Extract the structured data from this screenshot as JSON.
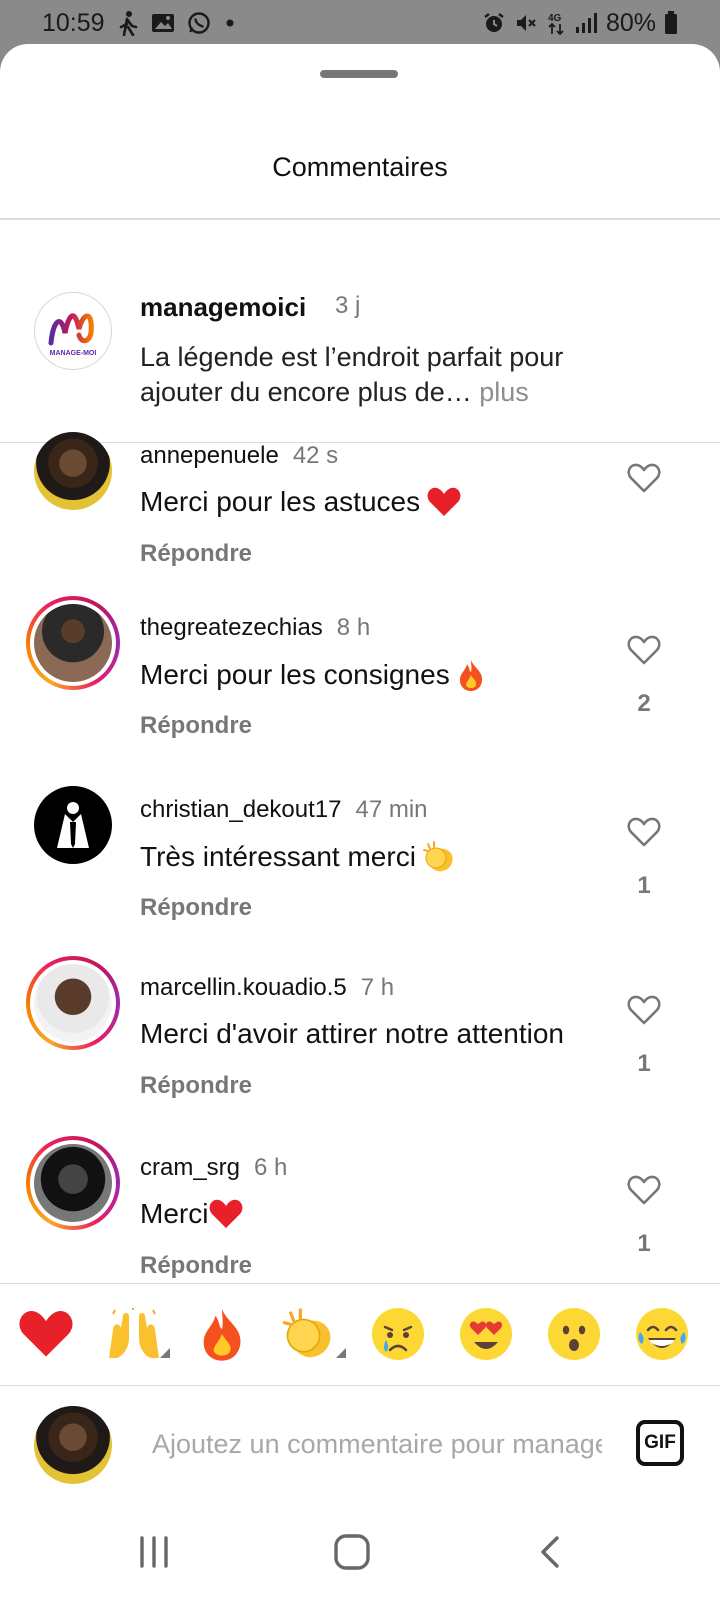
{
  "status_bar": {
    "time": "10:59",
    "battery": "80%",
    "network": "4G"
  },
  "sheet": {
    "title": "Commentaires"
  },
  "caption": {
    "author": "managemoici",
    "time": "3 j",
    "text": "La légende est l’endroit parfait pour ajouter du encore plus de…",
    "more_label": " plus",
    "logo_text": "MANAGE-MOI"
  },
  "comments": [
    {
      "author": "annepenuele",
      "time": "42 s",
      "text": "Merci pour les astuces",
      "emoji": "heart",
      "reply_label": "Répondre",
      "likes": ""
    },
    {
      "author": "thegreatezechias",
      "time": "8 h",
      "text": "Merci pour les consignes",
      "emoji": "fire",
      "reply_label": "Répondre",
      "likes": "2"
    },
    {
      "author": "christian_dekout17",
      "time": "47 min",
      "text": "Très intéressant merci",
      "emoji": "clap",
      "reply_label": "Répondre",
      "likes": "1"
    },
    {
      "author": "marcellin.kouadio.5",
      "time": "7 h",
      "text": "Merci d'avoir attirer notre attention",
      "emoji": "",
      "reply_label": "Répondre",
      "likes": "1"
    },
    {
      "author": "cram_srg",
      "time": "6 h",
      "text": "Merci",
      "emoji": "heart",
      "reply_label": "Répondre",
      "likes": "1"
    }
  ],
  "emoji_bar": [
    "heart",
    "raised-hands",
    "fire",
    "clap",
    "crying-face",
    "heart-eyes-face",
    "surprised-face",
    "tears-of-joy-face"
  ],
  "composer": {
    "placeholder": "Ajoutez un commentaire pour managemoici...",
    "gif_label": "GIF"
  },
  "colors": {
    "heart": "#e8202a",
    "secondary_text": "#777777",
    "story_ring_start": "#f9a825",
    "story_ring_end": "#c2185b"
  }
}
